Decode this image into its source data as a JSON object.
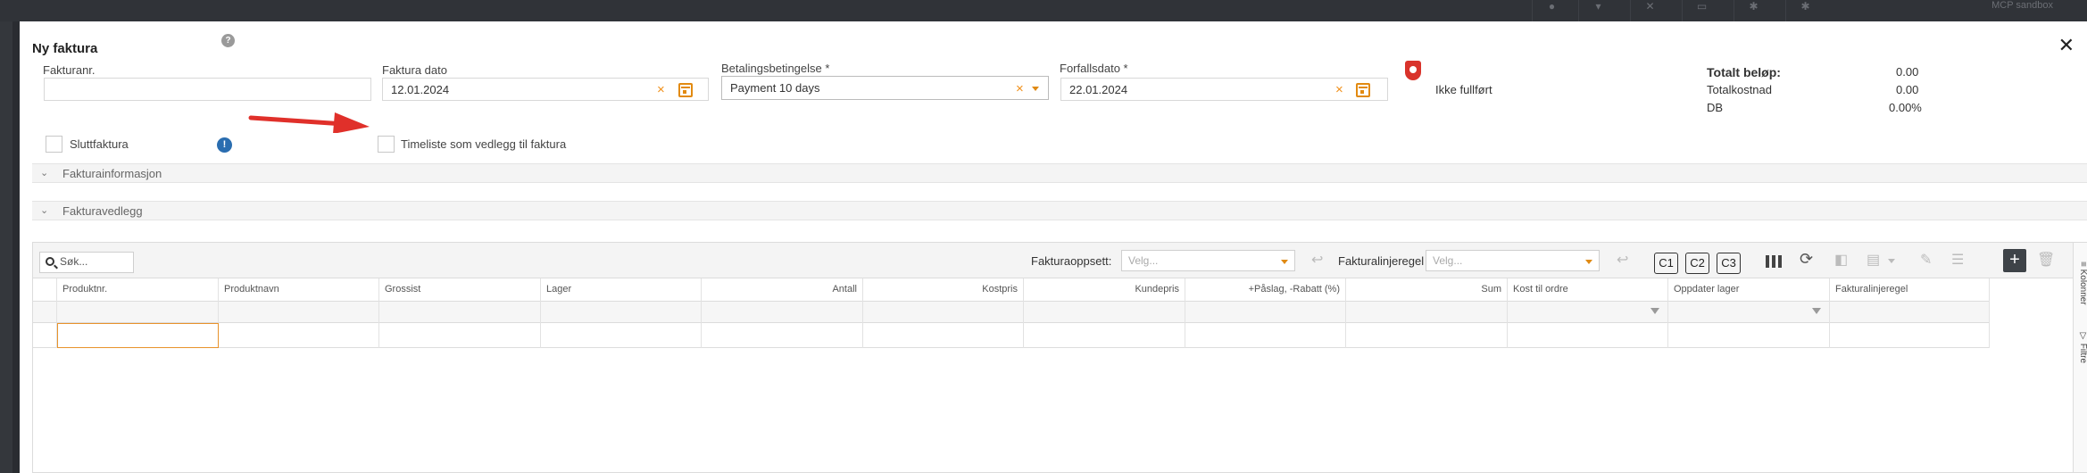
{
  "topbar": {
    "env_label": "MCP sandbox"
  },
  "dialog": {
    "title": "Ny faktura",
    "help_glyph": "?",
    "close_glyph": "✕"
  },
  "fields": {
    "invoice_number": {
      "label": "Fakturanr.",
      "value": ""
    },
    "invoice_date": {
      "label": "Faktura dato",
      "value": "12.01.2024"
    },
    "payment_terms": {
      "label": "Betalingsbetingelse *",
      "value": "Payment 10 days"
    },
    "due_date": {
      "label": "Forfallsdato *",
      "value": "22.01.2024"
    },
    "clear_glyph": "×"
  },
  "status": {
    "text": "Ikke fullført",
    "icon": "shield-icon",
    "color": "#d9332b"
  },
  "totals": {
    "total_label": "Totalt beløp:",
    "total_value": "0.00",
    "cost_label": "Totalkostnad",
    "cost_value": "0.00",
    "db_label": "DB",
    "db_value": "0.00%"
  },
  "checkboxes": {
    "final_invoice": {
      "label": "Sluttfaktura",
      "checked": false
    },
    "timesheet_attachment": {
      "label": "Timeliste som vedlegg til faktura",
      "checked": false
    },
    "info_glyph": "!"
  },
  "sections": [
    {
      "label": "Fakturainformasjon",
      "expanded": false
    },
    {
      "label": "Fakturavedlegg",
      "expanded": false
    }
  ],
  "chevron_glyph": "⌄",
  "toolbar": {
    "search_placeholder": "Søk...",
    "layout_label": "Fakturaoppsett:",
    "layout_placeholder": "Velg...",
    "rule_label": "Fakturalinjeregel",
    "rule_placeholder": "Velg...",
    "undo_glyph": "↩",
    "c_buttons": [
      "C1",
      "C2",
      "C3"
    ],
    "refresh_glyph": "⟳",
    "add_glyph": "+",
    "edit_glyph": "✎",
    "indent_glyph": "☰",
    "delete_glyph": "🗑",
    "doc_glyph": "▤",
    "compare_glyph": "◧"
  },
  "side_tabs": {
    "columns": "Kolonner",
    "filter": "Filtre"
  },
  "grid": {
    "columns": [
      "Produktnr.",
      "Produktnavn",
      "Grossist",
      "Lager",
      "Antall",
      "Kostpris",
      "Kundepris",
      "+Påslag, -Rabatt (%)",
      "Sum",
      "Kost til ordre",
      "Oppdater lager",
      "Fakturalinjeregel"
    ]
  },
  "colors": {
    "accent": "#e8932b",
    "info": "#2a6db0",
    "arrow": "#e0302a"
  }
}
